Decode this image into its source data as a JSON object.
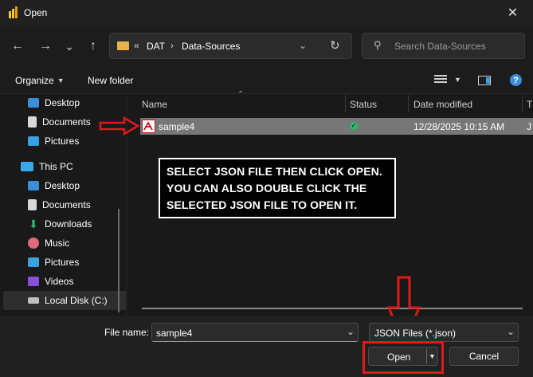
{
  "window": {
    "title": "Open",
    "close_glyph": "✕"
  },
  "nav": {
    "back_glyph": "←",
    "forward_glyph": "→",
    "recent_glyph": "⌄",
    "up_glyph": "↑",
    "breadcrumb": {
      "overflow": "«",
      "items": [
        "DAT",
        "Data-Sources"
      ],
      "separator": "›"
    },
    "refresh_glyph": "↻",
    "search_placeholder": "Search Data-Sources"
  },
  "toolbar": {
    "organize_label": "Organize",
    "new_folder_label": "New folder"
  },
  "sidebar": {
    "items": [
      {
        "label": "Desktop",
        "icon": "desktop-icon",
        "color": "#3b8ed8"
      },
      {
        "label": "Documents",
        "icon": "documents-icon",
        "color": "#d8d8d8"
      },
      {
        "label": "Pictures",
        "icon": "pictures-icon",
        "color": "#3aa0e0"
      },
      {
        "label": "This PC",
        "icon": "pc-icon",
        "color": "#3aa9e8"
      },
      {
        "label": "Desktop",
        "icon": "desktop-icon",
        "color": "#3b8ed8"
      },
      {
        "label": "Documents",
        "icon": "documents-icon",
        "color": "#d8d8d8"
      },
      {
        "label": "Downloads",
        "icon": "downloads-icon",
        "color": "#2fb86a"
      },
      {
        "label": "Music",
        "icon": "music-icon",
        "color": "#e06a7a"
      },
      {
        "label": "Pictures",
        "icon": "pictures-icon",
        "color": "#3aa0e0"
      },
      {
        "label": "Videos",
        "icon": "videos-icon",
        "color": "#8a4fd8"
      },
      {
        "label": "Local Disk (C:)",
        "icon": "disk-icon",
        "color": "#bfbfbf"
      }
    ]
  },
  "columns": {
    "name": "Name",
    "status": "Status",
    "date_modified": "Date modified",
    "type_partial": "T"
  },
  "files": [
    {
      "name": "sample4",
      "status_icon": "synced-check-icon",
      "date": "12/28/2025 10:15 AM",
      "type_partial": "J"
    }
  ],
  "annotation": {
    "lines": [
      "SELECT JSON FILE THEN CLICK OPEN.",
      "YOU CAN ALSO DOUBLE CLICK THE",
      "SELECTED JSON FILE TO OPEN IT."
    ],
    "arrow_color": "#e0191b"
  },
  "footer": {
    "file_name_label": "File name:",
    "file_name_value": "sample4",
    "file_type_value": "JSON Files (*.json)",
    "open_label": "Open",
    "cancel_label": "Cancel"
  }
}
